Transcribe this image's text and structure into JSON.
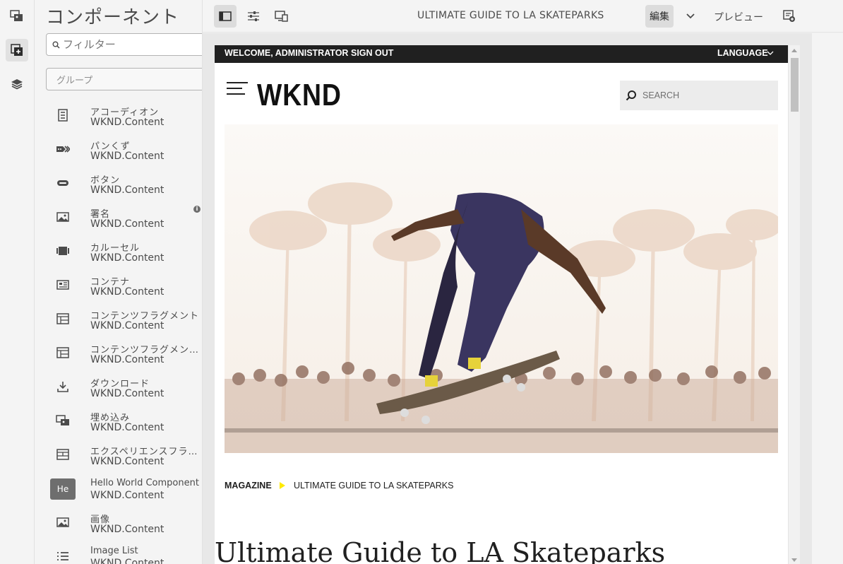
{
  "panel": {
    "title": "コンポーネント",
    "filter_placeholder": "フィルター",
    "group_placeholder": "グループ",
    "components": [
      {
        "name": "アコーディオン",
        "group": "WKND.Content",
        "icon": "accordion-icon"
      },
      {
        "name": "パンくず",
        "group": "WKND.Content",
        "icon": "breadcrumb-icon"
      },
      {
        "name": "ボタン",
        "group": "WKND.Content",
        "icon": "button-icon"
      },
      {
        "name": "署名",
        "group": "WKND.Content",
        "icon": "image-icon"
      },
      {
        "name": "カルーセル",
        "group": "WKND.Content",
        "icon": "carousel-icon"
      },
      {
        "name": "コンテナ",
        "group": "WKND.Content",
        "icon": "container-icon"
      },
      {
        "name": "コンテンツフラグメント",
        "group": "WKND.Content",
        "icon": "content-fragment-icon"
      },
      {
        "name": "コンテンツフラグメン…",
        "group": "WKND.Content",
        "icon": "content-fragment-list-icon"
      },
      {
        "name": "ダウンロード",
        "group": "WKND.Content",
        "icon": "download-icon"
      },
      {
        "name": "埋め込み",
        "group": "WKND.Content",
        "icon": "embed-icon"
      },
      {
        "name": "エクスペリエンスフラ…",
        "group": "WKND.Content",
        "icon": "experience-fragment-icon"
      },
      {
        "name": "Hello World Component",
        "group": "WKND.Content",
        "icon": "he-badge",
        "badge": "He"
      },
      {
        "name": "画像",
        "group": "WKND.Content",
        "icon": "image-icon"
      },
      {
        "name": "Image List",
        "group": "WKND.Content",
        "icon": "list-icon"
      }
    ]
  },
  "toolbar": {
    "page_title": "ULTIMATE GUIDE TO LA SKATEPARKS",
    "edit_label": "編集",
    "preview_label": "プレビュー"
  },
  "site": {
    "welcome": "WELCOME, ADMINISTRATOR",
    "sign_out": "SIGN OUT",
    "language": "LANGUAGE",
    "logo": "WKND",
    "search_placeholder": "SEARCH",
    "breadcrumb_parent": "MAGAZINE",
    "breadcrumb_current": "ULTIMATE GUIDE TO LA SKATEPARKS",
    "article_title": "Ultimate Guide to LA Skateparks"
  },
  "colors": {
    "accent_yellow": "#ffea00",
    "topbar": "#202020"
  }
}
